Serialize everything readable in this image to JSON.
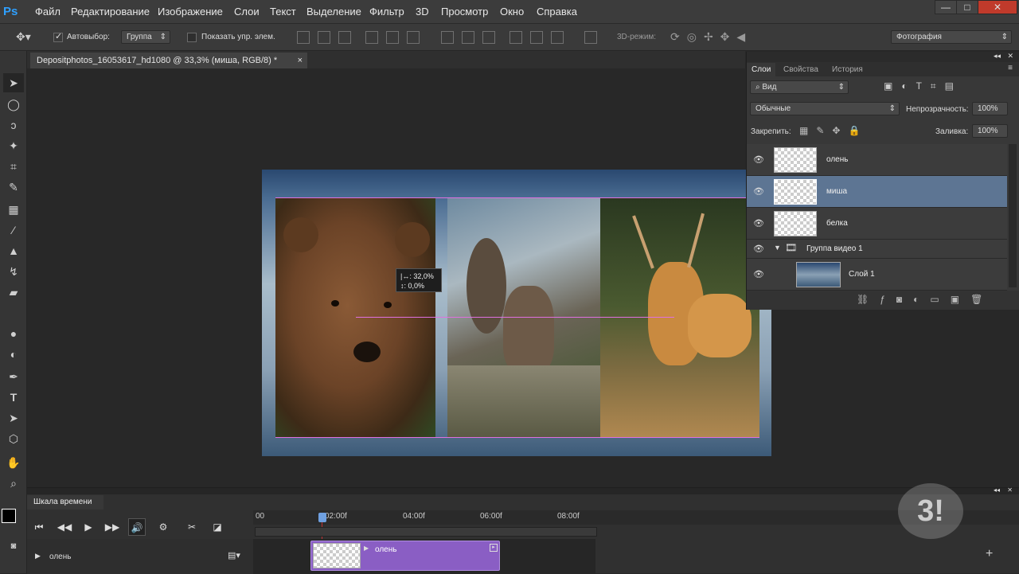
{
  "app": {
    "logo": "Ps"
  },
  "menu": [
    "Файл",
    "Редактирование",
    "Изображение",
    "Слои",
    "Текст",
    "Выделение",
    "Фильтр",
    "3D",
    "Просмотр",
    "Окно",
    "Справка"
  ],
  "window_controls": {
    "minimize": "—",
    "maximize": "□",
    "close": "✕"
  },
  "options": {
    "autoselect_label": "Автовыбор:",
    "autoselect_value": "Группа",
    "show_controls_label": "Показать упр. элем.",
    "mode3d_label": "3D-режим:",
    "workspace": "Фотография"
  },
  "document": {
    "tab_title": "Depositphotos_16053617_hd1080 @ 33,3% (миша, RGB/8) *",
    "close": "×"
  },
  "transform_hud": {
    "line1": "32,0%",
    "line2": "0,0%"
  },
  "layers_panel": {
    "tabs": [
      "Слои",
      "Свойства",
      "История"
    ],
    "filter_label": "Вид",
    "blend_mode": "Обычные",
    "opacity_label": "Непрозрачность:",
    "opacity_value": "100%",
    "lock_label": "Закрепить:",
    "fill_label": "Заливка:",
    "fill_value": "100%",
    "layers": [
      {
        "name": "олень",
        "selected": false
      },
      {
        "name": "миша",
        "selected": true
      },
      {
        "name": "белка",
        "selected": false
      },
      {
        "name": "Группа видео 1",
        "selected": false,
        "group": true
      },
      {
        "name": "Слой 1",
        "selected": false
      }
    ]
  },
  "timeline": {
    "title": "Шкала времени",
    "ruler": [
      "00",
      "02:00f",
      "04:00f",
      "06:00f",
      "08:00f"
    ],
    "track_label": "олень",
    "clip_label": "олень"
  },
  "colors": {
    "clip": "#8a5ec4",
    "selected_layer": "#5d7593",
    "guide": "#e070e0"
  }
}
